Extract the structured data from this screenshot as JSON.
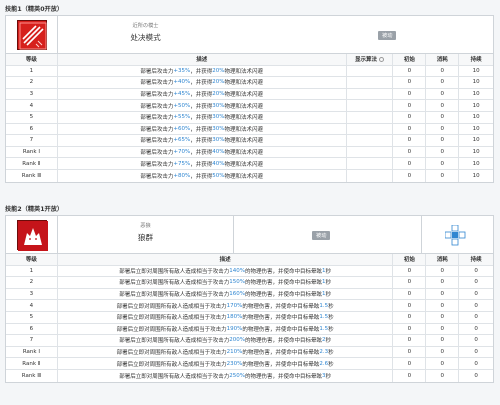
{
  "skill1": {
    "section_title": "技能1（精英0开放）",
    "icon": "skill-icon-sword-burst",
    "name_sub": "近所の模士",
    "name": "处决模式",
    "tag": "被动",
    "headers": {
      "level": "等级",
      "desc": "描述",
      "show": "显示算法",
      "init": "初始",
      "cost": "消耗",
      "dur": "持续"
    },
    "rows": [
      {
        "level": "1",
        "pre": "部署后攻击力",
        "val1": "+35%",
        "mid": "，并获得",
        "val2": "20%",
        "post": "物理和法术闪避",
        "init": "0",
        "cost": "0",
        "dur": "10"
      },
      {
        "level": "2",
        "pre": "部署后攻击力",
        "val1": "+40%",
        "mid": "，并获得",
        "val2": "20%",
        "post": "物理和法术闪避",
        "init": "0",
        "cost": "0",
        "dur": "10"
      },
      {
        "level": "3",
        "pre": "部署后攻击力",
        "val1": "+45%",
        "mid": "，并获得",
        "val2": "20%",
        "post": "物理和法术闪避",
        "init": "0",
        "cost": "0",
        "dur": "10"
      },
      {
        "level": "4",
        "pre": "部署后攻击力",
        "val1": "+50%",
        "mid": "，并获得",
        "val2": "30%",
        "post": "物理和法术闪避",
        "init": "0",
        "cost": "0",
        "dur": "10"
      },
      {
        "level": "5",
        "pre": "部署后攻击力",
        "val1": "+55%",
        "mid": "，并获得",
        "val2": "30%",
        "post": "物理和法术闪避",
        "init": "0",
        "cost": "0",
        "dur": "10"
      },
      {
        "level": "6",
        "pre": "部署后攻击力",
        "val1": "+60%",
        "mid": "，并获得",
        "val2": "30%",
        "post": "物理和法术闪避",
        "init": "0",
        "cost": "0",
        "dur": "10"
      },
      {
        "level": "7",
        "pre": "部署后攻击力",
        "val1": "+65%",
        "mid": "，并获得",
        "val2": "30%",
        "post": "物理和法术闪避",
        "init": "0",
        "cost": "0",
        "dur": "10"
      },
      {
        "level": "Rank Ⅰ",
        "pre": "部署后攻击力",
        "val1": "+70%",
        "mid": "，并获得",
        "val2": "40%",
        "post": "物理和法术闪避",
        "init": "0",
        "cost": "0",
        "dur": "10"
      },
      {
        "level": "Rank Ⅱ",
        "pre": "部署后攻击力",
        "val1": "+75%",
        "mid": "，并获得",
        "val2": "40%",
        "post": "物理和法术闪避",
        "init": "0",
        "cost": "0",
        "dur": "10"
      },
      {
        "level": "Rank Ⅲ",
        "pre": "部署后攻击力",
        "val1": "+80%",
        "mid": "，并获得",
        "val2": "50%",
        "post": "物理和法术闪避",
        "init": "0",
        "cost": "0",
        "dur": "10"
      }
    ]
  },
  "skill2": {
    "section_title": "技能2（精英1开放）",
    "icon": "skill-icon-wolf",
    "name_sub": "恶狼",
    "name": "狼群",
    "tag": "被动",
    "headers": {
      "level": "等级",
      "desc": "描述",
      "init": "初始",
      "cost": "消耗",
      "dur": "持续"
    },
    "rows": [
      {
        "level": "1",
        "pre": "部署后立即对周围所有敌人造成相当于攻击力",
        "val1": "140%",
        "mid": "的物理伤害，并使命中目标晕眩",
        "val2": "1",
        "post": "秒",
        "init": "0",
        "cost": "0",
        "dur": "0"
      },
      {
        "level": "2",
        "pre": "部署后立即对周围所有敌人造成相当于攻击力",
        "val1": "150%",
        "mid": "的物理伤害，并使命中目标晕眩",
        "val2": "1",
        "post": "秒",
        "init": "0",
        "cost": "0",
        "dur": "0"
      },
      {
        "level": "3",
        "pre": "部署后立即对周围所有敌人造成相当于攻击力",
        "val1": "160%",
        "mid": "的物理伤害，并使命中目标晕眩",
        "val2": "1",
        "post": "秒",
        "init": "0",
        "cost": "0",
        "dur": "0"
      },
      {
        "level": "4",
        "pre": "部署后立即对周围所有敌人造成相当于攻击力",
        "val1": "170%",
        "mid": "的物理伤害，并使命中目标晕眩",
        "val2": "1.5",
        "post": "秒",
        "init": "0",
        "cost": "0",
        "dur": "0"
      },
      {
        "level": "5",
        "pre": "部署后立即对周围所有敌人造成相当于攻击力",
        "val1": "180%",
        "mid": "的物理伤害，并使命中目标晕眩",
        "val2": "1.5",
        "post": "秒",
        "init": "0",
        "cost": "0",
        "dur": "0"
      },
      {
        "level": "6",
        "pre": "部署后立即对周围所有敌人造成相当于攻击力",
        "val1": "190%",
        "mid": "的物理伤害，并使命中目标晕眩",
        "val2": "1.5",
        "post": "秒",
        "init": "0",
        "cost": "0",
        "dur": "0"
      },
      {
        "level": "7",
        "pre": "部署后立即对周围所有敌人造成相当于攻击力",
        "val1": "200%",
        "mid": "的物理伤害，并使命中目标晕眩",
        "val2": "2",
        "post": "秒",
        "init": "0",
        "cost": "0",
        "dur": "0"
      },
      {
        "level": "Rank Ⅰ",
        "pre": "部署后立即对周围所有敌人造成相当于攻击力",
        "val1": "210%",
        "mid": "的物理伤害，并使命中目标晕眩",
        "val2": "2.3",
        "post": "秒",
        "init": "0",
        "cost": "0",
        "dur": "0"
      },
      {
        "level": "Rank Ⅱ",
        "pre": "部署后立即对周围所有敌人造成相当于攻击力",
        "val1": "230%",
        "mid": "的物理伤害，并使命中目标晕眩",
        "val2": "2.6",
        "post": "秒",
        "init": "0",
        "cost": "0",
        "dur": "0"
      },
      {
        "level": "Rank Ⅲ",
        "pre": "部署后立即对周围所有敌人造成相当于攻击力",
        "val1": "250%",
        "mid": "的物理伤害，并使命中目标晕眩",
        "val2": "3",
        "post": "秒",
        "init": "0",
        "cost": "0",
        "dur": "0"
      }
    ]
  },
  "colors": {
    "accent_blue": "#2f86d1",
    "icon_red": "#d6201c",
    "range_blue": "#2f86d1"
  }
}
